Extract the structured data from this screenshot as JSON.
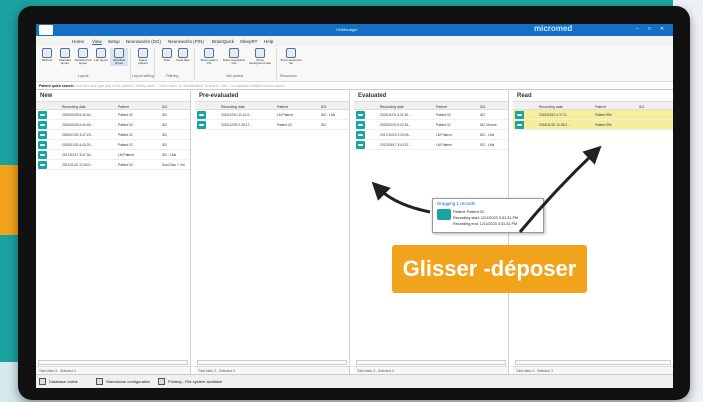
{
  "app": {
    "title": "VirtManager",
    "brand": "micromed",
    "window_controls": [
      "–",
      "□",
      "✕"
    ]
  },
  "menu": [
    "Home",
    "View",
    "Setup",
    "Neuroworks (DG)",
    "Neuroworks (PIN)",
    "BrainQuick",
    "SleepRT",
    "Help"
  ],
  "menu_active": "View",
  "ribbon": {
    "buttons": [
      "Refresh",
      "Standard layout",
      "Standard left layout",
      "Left layout",
      "Workflow layout",
      "Space adjusts",
      "Filter",
      "Clear filter",
      "Show patient info",
      "Show acquisition info",
      "Show background task",
      "Show resources list"
    ],
    "groups": [
      "Layout",
      "Layout setting",
      "Filtering",
      "Info panels",
      "Resources"
    ]
  },
  "search": {
    "label": "Patient quick search:",
    "placeholder": "Click here and type part of the patient's 'family name', 'Given name' or 'identification' to search. Use ';' to separate multiple search values"
  },
  "columns": [
    "Recording date",
    "Patient",
    "ID1"
  ],
  "panels": [
    {
      "title": "New",
      "rows": [
        {
          "date": "2020/05/25 6:40:40...",
          "patient": "Patient 02",
          "id": "ID2"
        },
        {
          "date": "2020/05/25 6:40:45...",
          "patient": "Patient 02",
          "id": "ID2"
        },
        {
          "date": "2020/01/30 3:47:23...",
          "patient": "Patient 02",
          "id": "ID2"
        },
        {
          "date": "2020/01/30 4:43:20...",
          "patient": "Patient 02",
          "id": "ID2"
        },
        {
          "date": "2017/02/17 3:47:30...",
          "patient": "LM Patient",
          "id": "ID2 - LMs"
        },
        {
          "date": "2012/11/10 12:40:0...",
          "patient": "Patient 02",
          "id": "Suni Dico + Vro"
        }
      ],
      "footer": "Total visits: 6 - Selected: 0"
    },
    {
      "title": "Pre-evaluated",
      "rows": [
        {
          "date": "2023/12/10 11:41:0...",
          "patient": "LM Patient",
          "id": "ID2 - LMs"
        },
        {
          "date": "2023/12/09 2:39:17...",
          "patient": "Patient 02",
          "id": "ID2"
        }
      ],
      "footer": "Total visits: 2 - Selected: 0"
    },
    {
      "title": "Evaluated",
      "rows": [
        {
          "date": "2023/11/01 3:31:30...",
          "patient": "Patient 02",
          "id": "ID2"
        },
        {
          "date": "2023/02/20 9:22:51...",
          "patient": "Patient 01",
          "id": "ID2 Vtrome"
        },
        {
          "date": "2017/10/15 2:23:05...",
          "patient": "LM Patient",
          "id": "ID2 - LMs"
        },
        {
          "date": "2017/05/17 3:43:37...",
          "patient": "LM Patient",
          "id": "ID2 - LMs"
        }
      ],
      "footer": "Total visits: 4 - Selected: 0"
    },
    {
      "title": "Read",
      "rows": [
        {
          "date": "2023/03/10 1:17:3...",
          "patient": "Patient 99s",
          "id": ""
        },
        {
          "date": "2018/11/20 12:36:2...",
          "patient": "Patient 99s",
          "id": ""
        }
      ],
      "footer": "Total visits: 2 - Selected: 2"
    }
  ],
  "tooltip": {
    "title": "Dragging 1 records",
    "patient": "Patient: Patient 02",
    "start": "Recording start: 12/1/2023 3:31:31 PM",
    "end": "Recording end: 12/1/2023 3:31:31 PM"
  },
  "overlay_label": "Glisser -déposer",
  "status": {
    "db": "Database online",
    "ws": "Standalone configuration",
    "print": "Printing - File system available"
  },
  "colors": {
    "accent": "#1570c4",
    "teal": "#1aa3a3",
    "orange": "#f0a31b",
    "selected_row": "#f5ee9c"
  }
}
